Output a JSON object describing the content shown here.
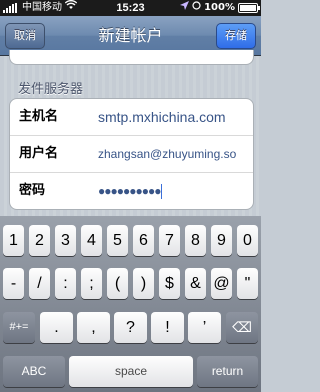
{
  "status_bar": {
    "carrier": "中国移动",
    "time": "15:23",
    "battery": "100%"
  },
  "nav": {
    "cancel": "取消",
    "title": "新建帐户",
    "save": "存储"
  },
  "section": {
    "title": "发件服务器",
    "rows": [
      {
        "label": "主机名",
        "value": "smtp.mxhichina.com"
      },
      {
        "label": "用户名",
        "value": "zhangsan@zhuyuming.so"
      },
      {
        "label": "密码",
        "value": "●●●●●●●●●●"
      }
    ]
  },
  "keyboard": {
    "row1": [
      "1",
      "2",
      "3",
      "4",
      "5",
      "6",
      "7",
      "8",
      "9",
      "0"
    ],
    "row2": [
      "-",
      "/",
      ":",
      ";",
      "(",
      ")",
      "$",
      "&",
      "@",
      "\""
    ],
    "row3": [
      "#+=",
      ".",
      ",",
      "?",
      "!",
      "’",
      "⌫"
    ],
    "row4": [
      "ABC",
      "space",
      "return"
    ]
  }
}
